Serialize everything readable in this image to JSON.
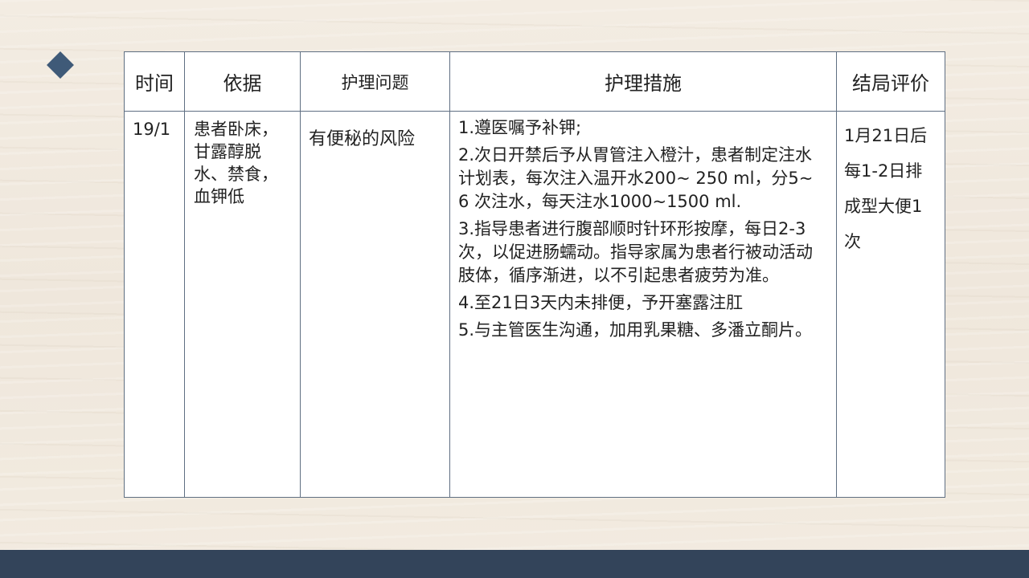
{
  "table": {
    "headers": [
      "时间",
      "依据",
      "护理问题",
      "护理措施",
      "结局评价"
    ],
    "row": {
      "time": "19/1",
      "basis": "患者卧床，甘露醇脱水、禁食，血钾低",
      "problem": "有便秘的风险",
      "measures": [
        "1.遵医嘱予补钾;",
        "2.次日开禁后予从胃管注入橙汁，患者制定注水计划表，每次注入温开水200~ 250 ml，分5~ 6 次注水，每天注水1000~1500 ml.",
        "3.指导患者进行腹部顺时针环形按摩，每日2-3次，以促进肠蠕动。指导家属为患者行被动活动肢体，循序渐进，以不引起患者疲劳为准。",
        "4.至21日3天内未排便，予开塞露注肛",
        "5.与主管医生沟通，加用乳果糖、多潘立酮片。"
      ],
      "evaluation": "1月21日后每1-2日排成型大便1次"
    }
  },
  "colors": {
    "accent": "#3f5a78",
    "footer": "#33445a",
    "border": "#5f6f82"
  }
}
